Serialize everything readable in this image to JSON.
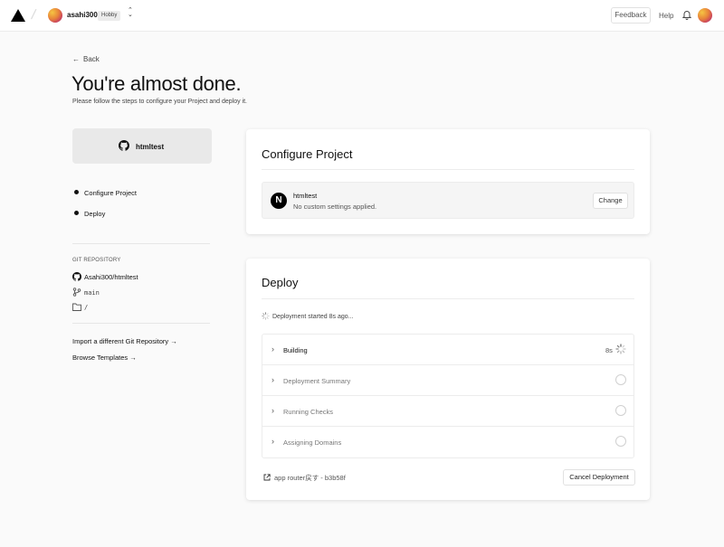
{
  "header": {
    "team_name": "asahi300",
    "plan_badge": "Hobby",
    "feedback_label": "Feedback",
    "help_label": "Help"
  },
  "nav": {
    "back_label": "Back"
  },
  "page": {
    "title": "You're almost done.",
    "subtitle": "Please follow the steps to configure your Project and deploy it."
  },
  "repo_card": {
    "name": "htmltest"
  },
  "steps": [
    {
      "label": "Configure Project"
    },
    {
      "label": "Deploy"
    }
  ],
  "git": {
    "section_label": "GIT REPOSITORY",
    "repo": "Asahi300/htmltest",
    "branch": "main",
    "root_dir": "/"
  },
  "links": {
    "import_label": "Import a different Git Repository →",
    "templates_label": "Browse Templates →"
  },
  "configure": {
    "title": "Configure Project",
    "framework_icon": "N",
    "project_name": "htmltest",
    "settings_text": "No custom settings applied.",
    "change_label": "Change"
  },
  "deploy": {
    "title": "Deploy",
    "status_text": "Deployment started 8s ago...",
    "steps": [
      {
        "label": "Building",
        "time": "8s",
        "state": "running"
      },
      {
        "label": "Deployment Summary",
        "time": "",
        "state": "pending"
      },
      {
        "label": "Running Checks",
        "time": "",
        "state": "pending"
      },
      {
        "label": "Assigning Domains",
        "time": "",
        "state": "pending"
      }
    ],
    "commit_text": "app router戻す - b3b58f",
    "cancel_label": "Cancel Deployment"
  },
  "icons": {
    "logo": "vercel-triangle-icon",
    "switcher": "chevron-up-down-icon",
    "notifications": "bell-icon",
    "github": "github-icon",
    "branch": "git-branch-icon",
    "folder": "folder-icon",
    "spinner": "spinner-icon",
    "external": "external-link-icon"
  }
}
